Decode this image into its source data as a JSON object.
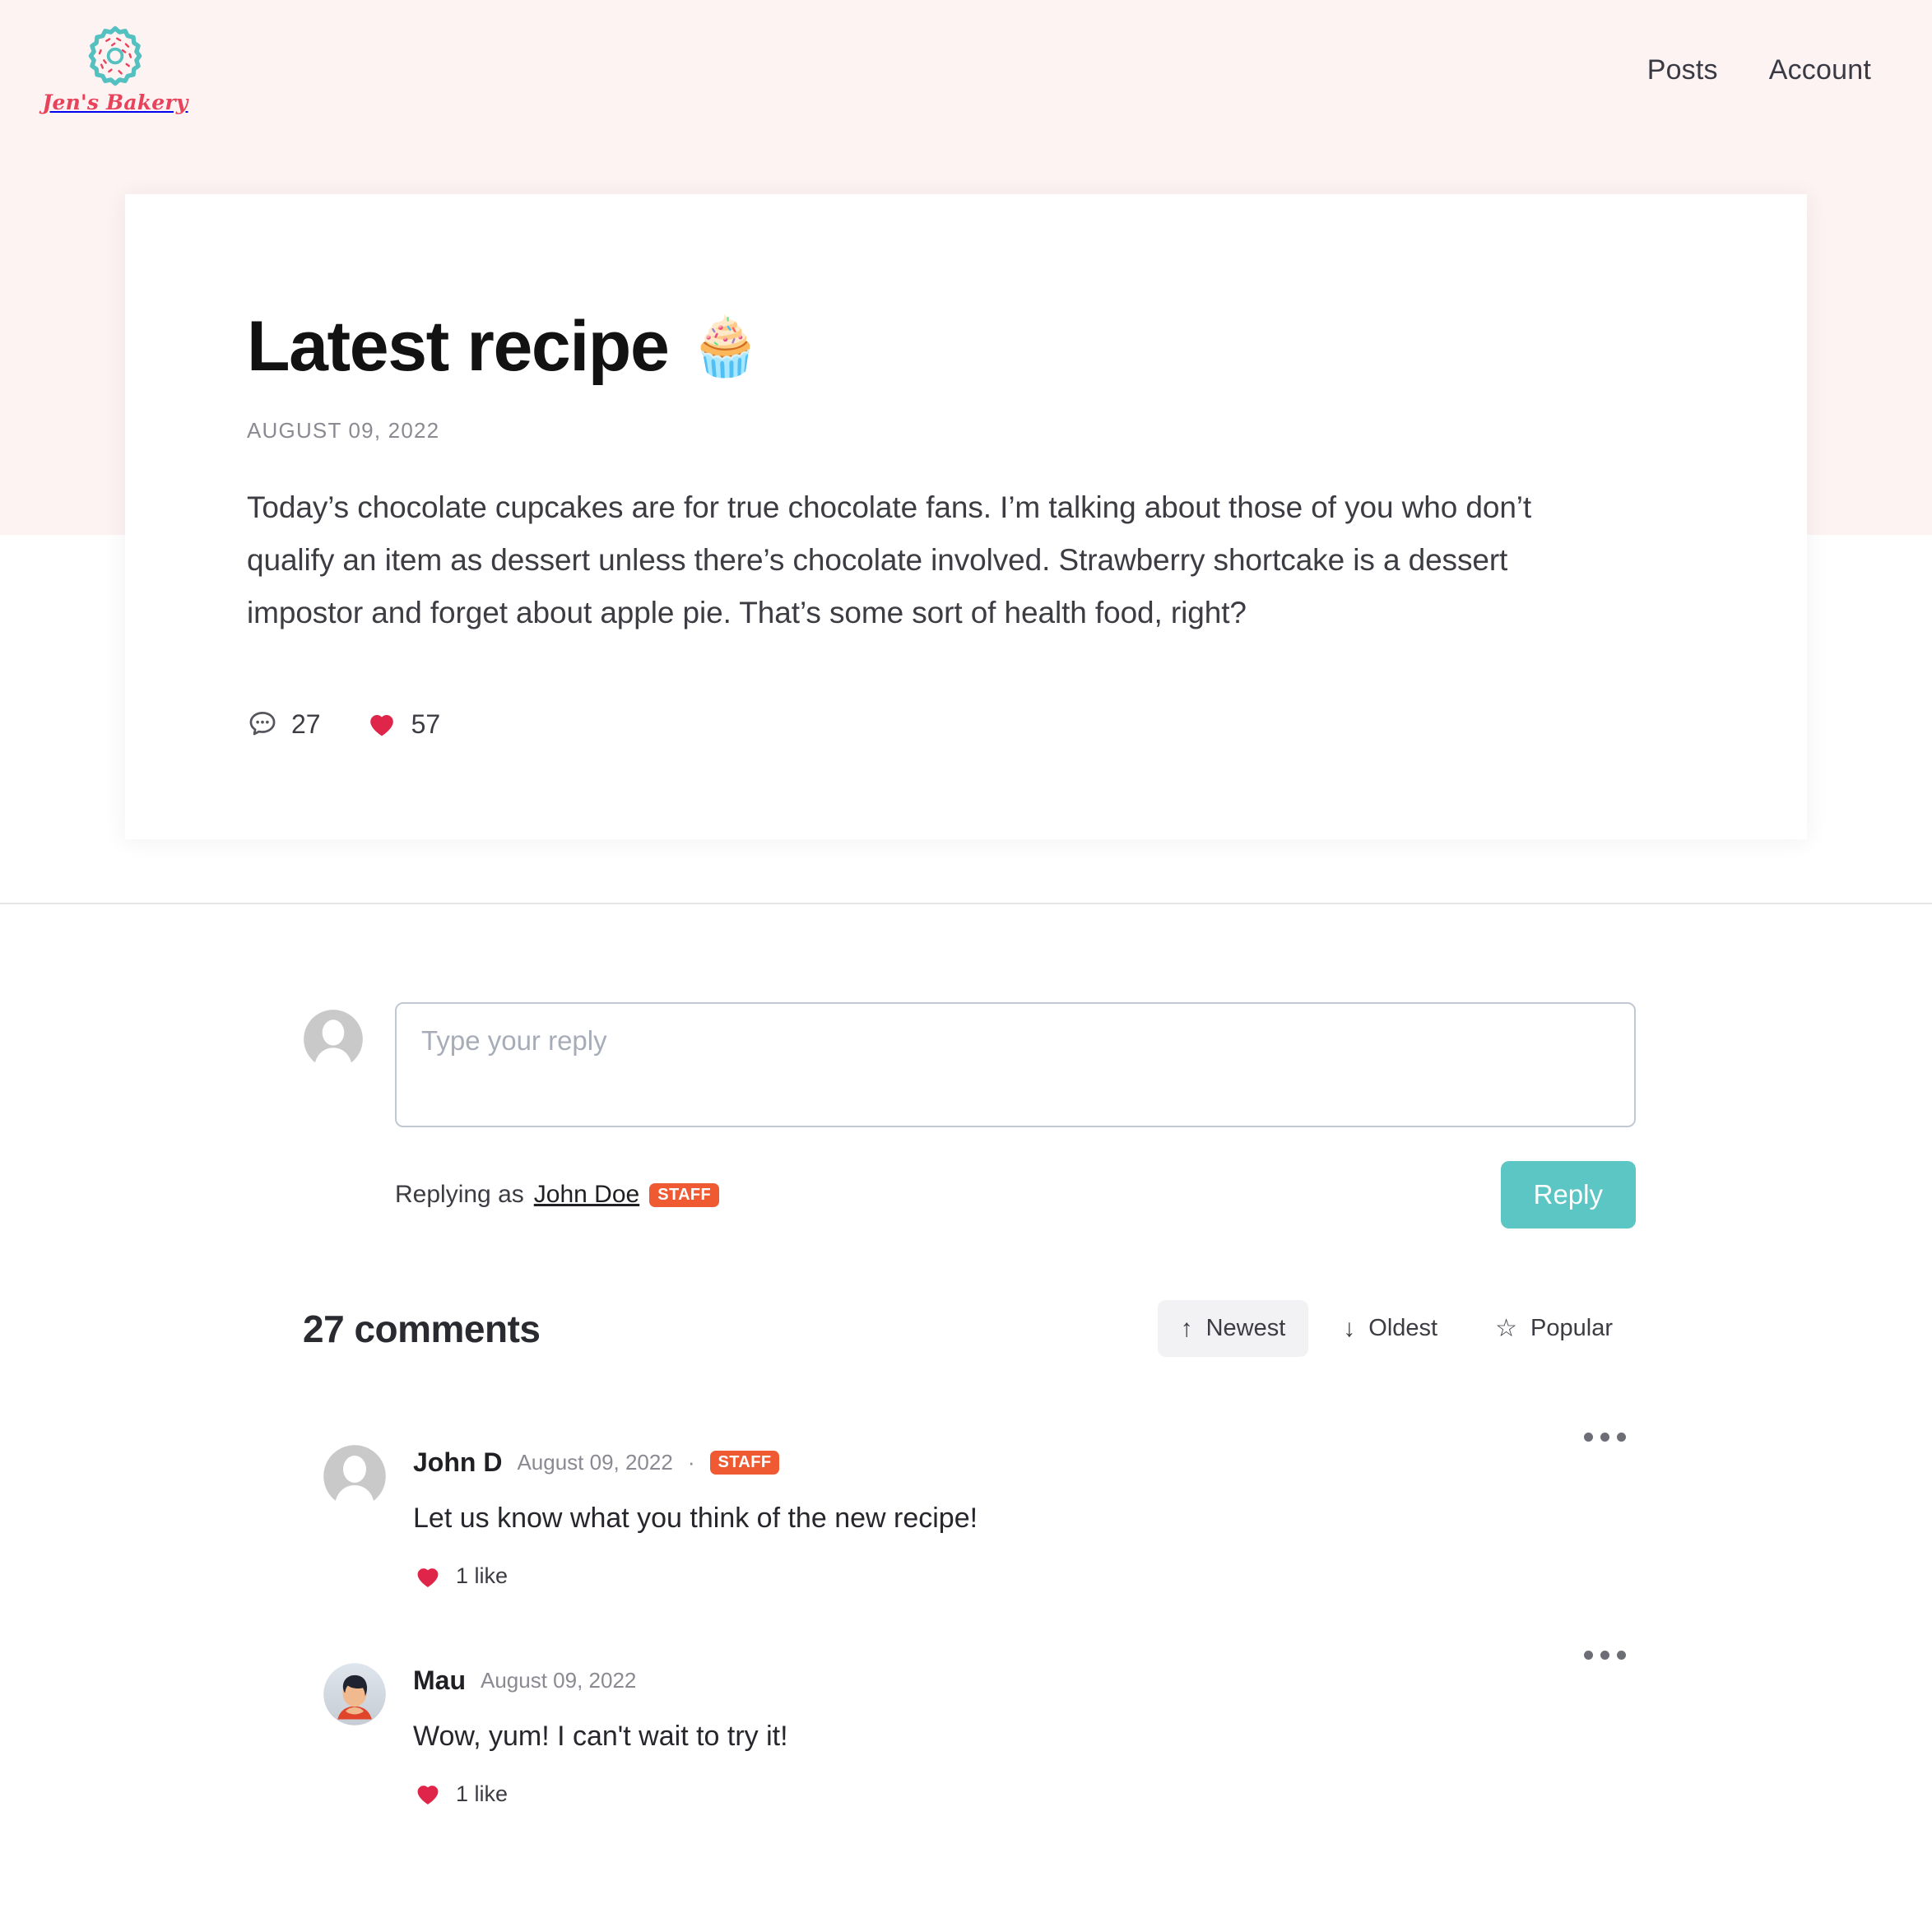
{
  "site": {
    "brand_name": "Jen's Bakery",
    "logo_icon": "donut-icon",
    "nav": [
      {
        "label": "Posts",
        "name": "nav-link-posts"
      },
      {
        "label": "Account",
        "name": "nav-link-account"
      }
    ]
  },
  "post": {
    "title": "Latest recipe",
    "title_emoji": "🧁",
    "date": "AUGUST 09, 2022",
    "body": "Today’s chocolate cupcakes are for true chocolate fans. I’m talking about those of you who don’t qualify an item as dessert unless there’s chocolate involved. Strawberry shortcake is a dessert impostor and forget about apple pie. That’s some sort of health food, right?",
    "comment_count": "27",
    "like_count": "57",
    "comment_icon": "speech-bubble-icon",
    "like_icon": "heart-icon"
  },
  "composer": {
    "placeholder": "Type your reply",
    "value": "",
    "replying_prefix": "Replying as",
    "replying_name": "John Doe",
    "replying_badge": "STAFF",
    "submit_label": "Reply",
    "avatar_icon": "default-avatar-icon"
  },
  "comments_section": {
    "heading": "27 comments",
    "sort_options": [
      {
        "label": "Newest",
        "icon": "↑",
        "icon_name": "arrow-up-icon",
        "active": true
      },
      {
        "label": "Oldest",
        "icon": "↓",
        "icon_name": "arrow-down-icon",
        "active": false
      },
      {
        "label": "Popular",
        "icon": "☆",
        "icon_name": "star-icon",
        "active": false
      }
    ],
    "more_icon": "more-options-icon",
    "comments": [
      {
        "author": "John D",
        "date": "August 09, 2022",
        "separator": "·",
        "badge": "STAFF",
        "text": "Let us know what you think of the new recipe!",
        "likes": "1 like",
        "avatar": "default"
      },
      {
        "author": "Mau",
        "date": "August 09, 2022",
        "separator": "",
        "badge": "",
        "text": "Wow, yum! I can't wait to try it!",
        "likes": "1 like",
        "avatar": "photo"
      }
    ]
  },
  "colors": {
    "header_bg": "#fdf3f3",
    "brand_pink": "#e8435a",
    "brand_teal": "#5bc6c3",
    "badge_orange": "#f05a32",
    "heart_red": "#e0254b"
  }
}
